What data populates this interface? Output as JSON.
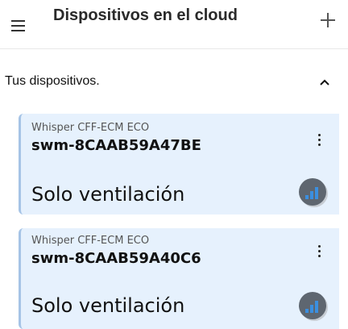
{
  "header": {
    "title": "Dispositivos en el cloud"
  },
  "section": {
    "title": "Tus dispositivos."
  },
  "devices": [
    {
      "model": "Whisper CFF-ECM ECO",
      "id": "swm-8CAAB59A47BE",
      "mode": "Solo ventilación"
    },
    {
      "model": "Whisper CFF-ECM ECO",
      "id": "swm-8CAAB59A40C6",
      "mode": "Solo ventilación"
    }
  ],
  "colors": {
    "card_background": "#e6f1fd",
    "card_accent": "#a6c4e6",
    "signal_badge": "#5e6670",
    "signal_bars": "#3b8fe0"
  },
  "icons": {
    "menu": "hamburger-menu-icon",
    "add": "plus-icon",
    "collapse": "chevron-up-icon",
    "more": "more-vert-icon",
    "signal": "signal-strength-icon"
  }
}
